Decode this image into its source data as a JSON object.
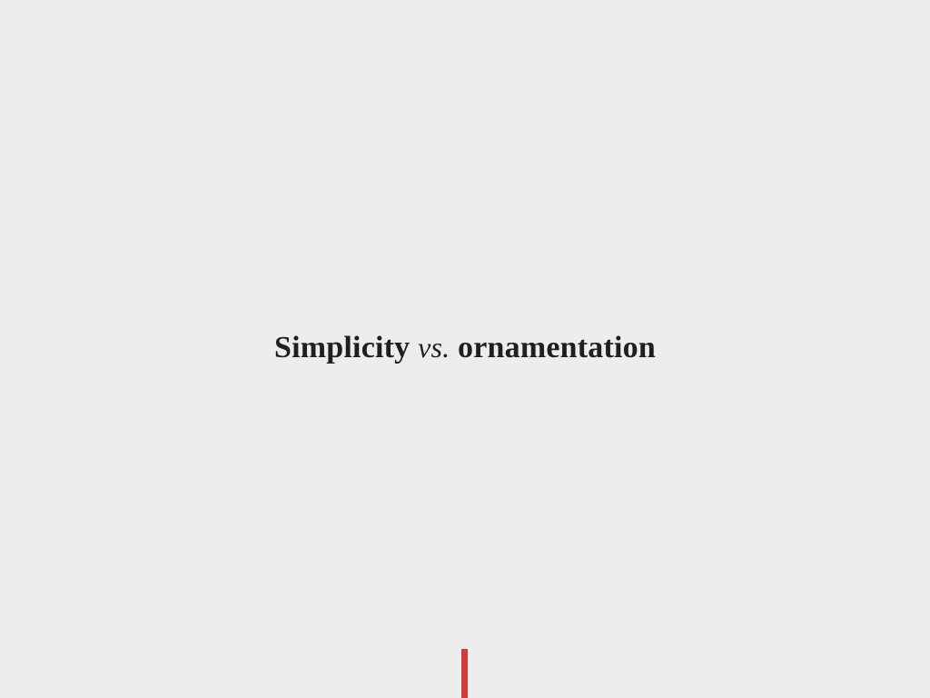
{
  "slide": {
    "title": {
      "left": "Simplicity",
      "connector": "vs.",
      "right": "ornamentation"
    }
  },
  "colors": {
    "background": "#EDEDED",
    "text": "#1F1F1F",
    "accent": "#D03A3A"
  }
}
